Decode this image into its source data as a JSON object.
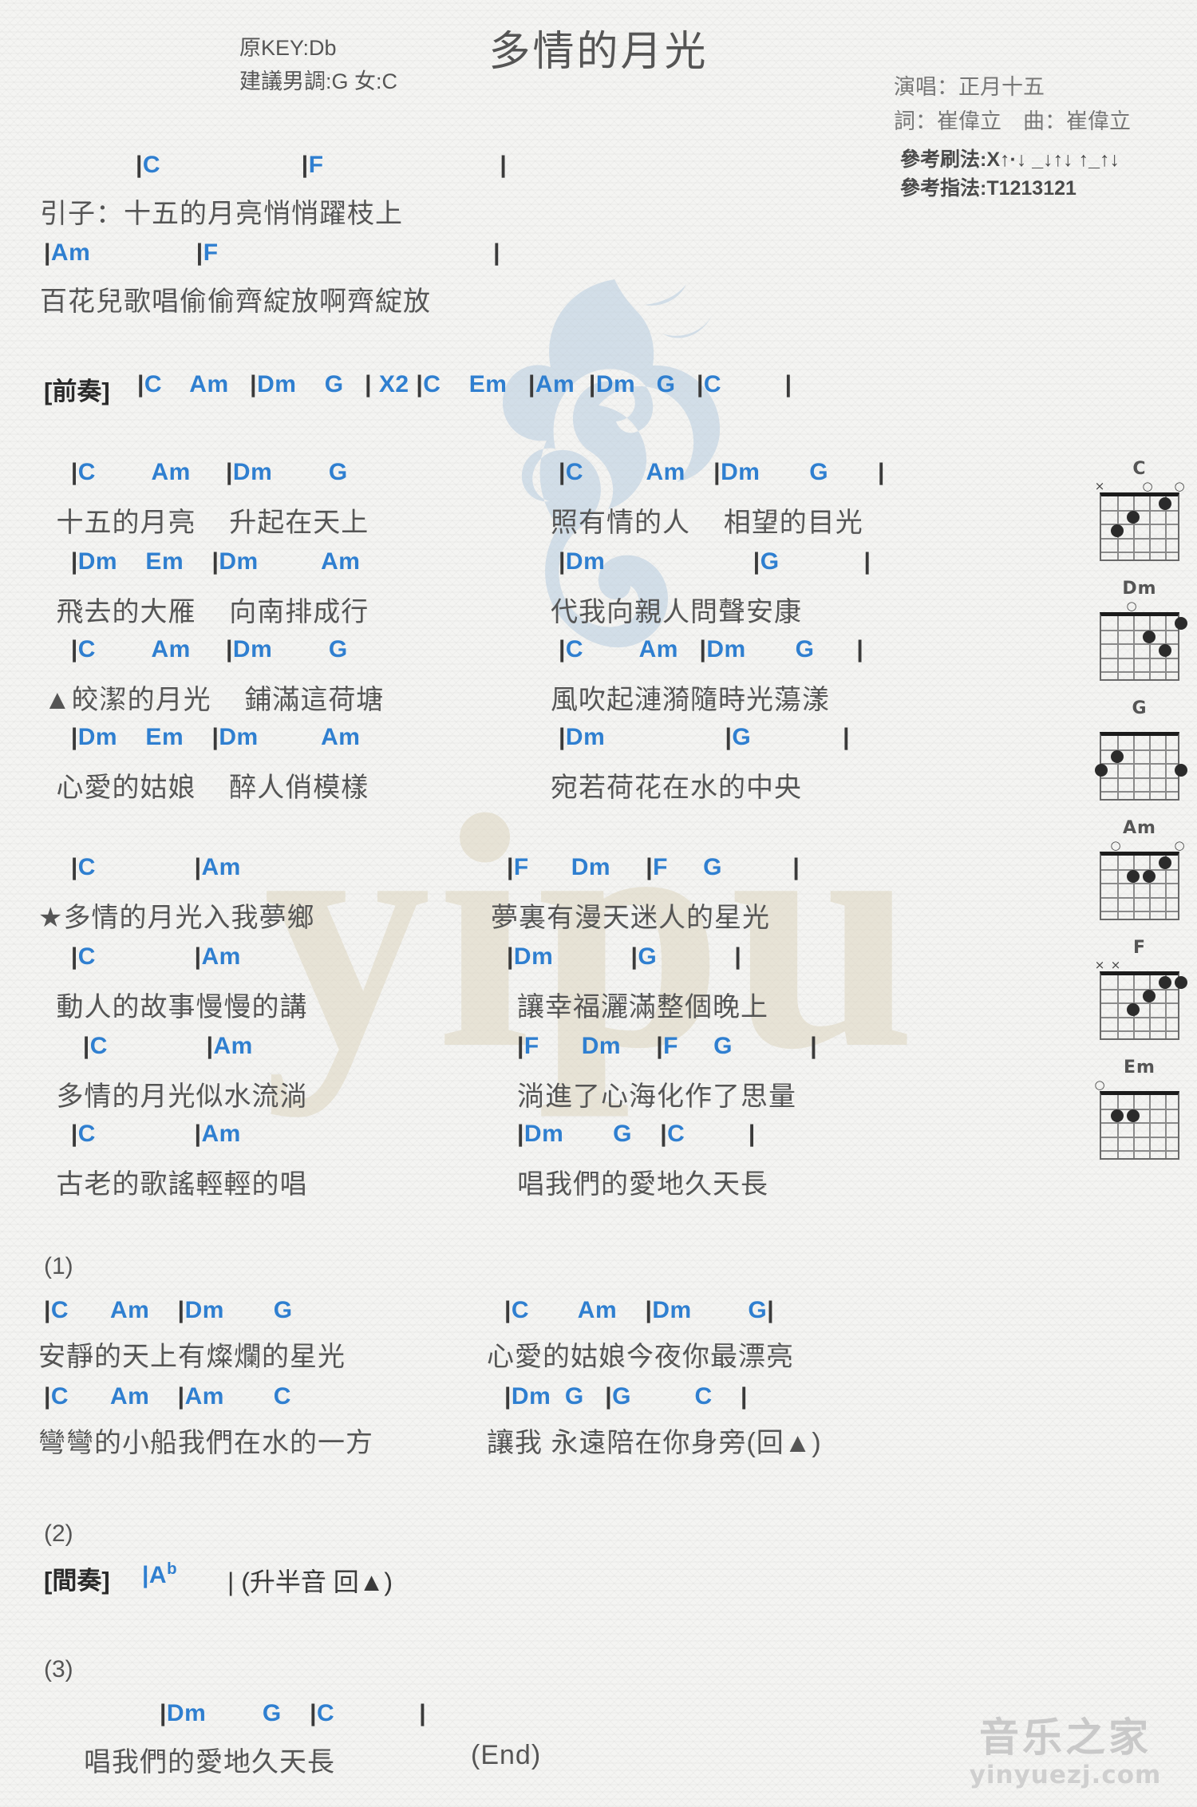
{
  "header": {
    "title": "多情的月光",
    "original_key": "原KEY:Db",
    "suggested_key": "建議男調:G 女:C",
    "singer": "演唱：正月十五",
    "writers": "詞：崔偉立　曲：崔偉立",
    "strumming": "參考刷法:X↑·↓ _↓↑↓ ↑_↑↓",
    "fingering": "參考指法:T1213121"
  },
  "intro": {
    "chords_1": "|C                    |F                         |",
    "lyrics_1": "引子：十五的月亮悄悄躍枝上",
    "chords_2": "|Am               |F                                       |",
    "lyrics_2": "百花兒歌唱偷偷齊綻放啊齊綻放"
  },
  "prelude": {
    "label": "[前奏]",
    "chords": "|C    Am   |Dm    G   | X2 |C    Em   |Am  |Dm   G   |C         |"
  },
  "verse": [
    {
      "chords_left": " |C        Am     |Dm        G",
      "chords_right": "|C         Am    |Dm       G       |",
      "lyrics_left": " 十五的月亮    升起在天上",
      "lyrics_right": "照有情的人    相望的目光"
    },
    {
      "chords_left": " |Dm    Em    |Dm         Am",
      "chords_right": "|Dm                     |G            |",
      "lyrics_left": " 飛去的大雁    向南排成行",
      "lyrics_right": "代我向親人問聲安康"
    },
    {
      "chords_left": " |C        Am     |Dm        G",
      "chords_right": "|C        Am   |Dm       G      |",
      "lyrics_left": "▲皎潔的月光    鋪滿這荷塘",
      "lyrics_right": "風吹起漣漪隨時光蕩漾"
    },
    {
      "chords_left": " |Dm    Em    |Dm         Am",
      "chords_right": "|Dm                 |G             |",
      "lyrics_left": " 心愛的姑娘    醉人俏模樣",
      "lyrics_right": "宛若荷花在水的中央"
    }
  ],
  "chorus": [
    {
      "chords_left": " |C              |Am",
      "chords_right": "|F      Dm     |F     G          |",
      "lyrics_left": "★多情的月光入我夢鄉",
      "lyrics_right": "夢裏有漫天迷人的星光"
    },
    {
      "chords_left": " |C              |Am",
      "chords_right": "|Dm           |G           |",
      "lyrics_left": " 動人的故事慢慢的講",
      "lyrics_right": "讓幸福灑滿整個晚上"
    },
    {
      "chords_left": " |C              |Am",
      "chords_right": "|F      Dm     |F     G           |",
      "lyrics_left": " 多情的月光似水流淌",
      "lyrics_right": "淌進了心海化作了思量"
    },
    {
      "chords_left": " |C              |Am",
      "chords_right": "|Dm       G    |C         |",
      "lyrics_left": " 古老的歌謠輕輕的唱",
      "lyrics_right": "唱我們的愛地久天長"
    }
  ],
  "endings": {
    "num_1": "(1)",
    "ending1": [
      {
        "chords_left": "|C      Am    |Dm       G",
        "chords_right": "|C       Am    |Dm        G|",
        "lyrics_left": "安靜的天上有燦爛的星光",
        "lyrics_right": "心愛的姑娘今夜你最漂亮"
      },
      {
        "chords_left": "|C      Am    |Am       C",
        "chords_right": "|Dm  G   |G         C    |",
        "lyrics_left": "彎彎的小船我們在水的一方",
        "lyrics_right": "讓我 永遠陪在你身旁(回▲)"
      }
    ],
    "num_2": "(2)",
    "interlude_label": "[間奏]",
    "interlude_chord_main": "|A",
    "interlude_chord_flat": "b",
    "interlude_note": "| (升半音 回▲)",
    "num_3": "(3)",
    "ending3": {
      "chords": "|Dm        G    |C            |",
      "lyrics": "唱我們的愛地久天長",
      "end_marker": "(End)"
    }
  },
  "chord_diagrams": [
    {
      "name": "C",
      "markers": [
        {
          "sym": "x",
          "string": 6
        },
        {
          "sym": "o",
          "string": 3
        },
        {
          "sym": "o",
          "string": 1
        }
      ],
      "dots": [
        {
          "string": 5,
          "fret": 3
        },
        {
          "string": 4,
          "fret": 2
        },
        {
          "string": 2,
          "fret": 1
        }
      ]
    },
    {
      "name": "Dm",
      "markers": [
        {
          "sym": "o",
          "string": 4
        }
      ],
      "dots": [
        {
          "string": 1,
          "fret": 1
        },
        {
          "string": 3,
          "fret": 2
        },
        {
          "string": 2,
          "fret": 3
        }
      ]
    },
    {
      "name": "G",
      "markers": [],
      "dots": [
        {
          "string": 5,
          "fret": 2
        },
        {
          "string": 6,
          "fret": 3
        },
        {
          "string": 1,
          "fret": 3
        }
      ]
    },
    {
      "name": "Am",
      "markers": [
        {
          "sym": "o",
          "string": 5
        },
        {
          "sym": "o",
          "string": 1
        }
      ],
      "dots": [
        {
          "string": 2,
          "fret": 1
        },
        {
          "string": 4,
          "fret": 2
        },
        {
          "string": 3,
          "fret": 2
        }
      ]
    },
    {
      "name": "F",
      "markers": [
        {
          "sym": "x",
          "string": 6
        },
        {
          "sym": "x",
          "string": 5
        }
      ],
      "dots": [
        {
          "string": 2,
          "fret": 1
        },
        {
          "string": 1,
          "fret": 1
        },
        {
          "string": 3,
          "fret": 2
        },
        {
          "string": 4,
          "fret": 3
        }
      ]
    },
    {
      "name": "Em",
      "markers": [
        {
          "sym": "o",
          "string": 6
        }
      ],
      "dots": [
        {
          "string": 5,
          "fret": 2
        },
        {
          "string": 4,
          "fret": 2
        }
      ]
    }
  ],
  "site_logo": {
    "cn": "音乐之家",
    "url": "yinyuezj.com"
  },
  "watermark": {
    "text": "yipu"
  },
  "colors": {
    "chord": "#2f7fd0",
    "lyric": "#555555",
    "bar": "#3a3a3a",
    "watermark_blue": "#b8cde0",
    "watermark_tan": "#ded6c0"
  }
}
